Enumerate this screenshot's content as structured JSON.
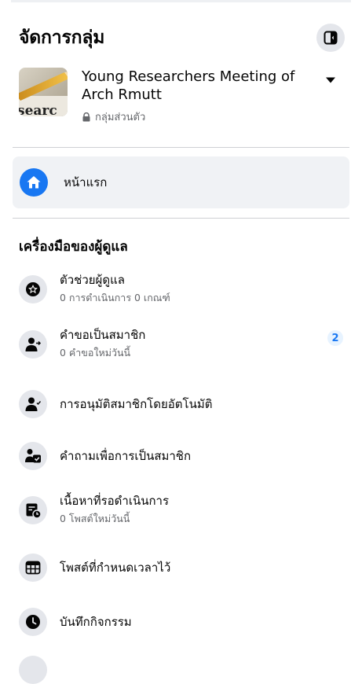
{
  "header": {
    "title": "จัดการกลุ่ม"
  },
  "group": {
    "name": "Young Researchers Meeting of Arch Rmutt",
    "privacy": "กลุ่มส่วนตัว",
    "thumbnail_text": "searc"
  },
  "nav": {
    "home_label": "หน้าแรก"
  },
  "admin_tools": {
    "title": "เครื่องมือของผู้ดูแล",
    "items": [
      {
        "label": "ตัวช่วยผู้ดูแล",
        "sub": "0 การดำเนินการ 0 เกณฑ์",
        "icon": "admin-assist-icon"
      },
      {
        "label": "คำขอเป็นสมาชิก",
        "sub": "0 คำขอใหม่วันนี้",
        "badge": "2",
        "icon": "member-request-icon"
      },
      {
        "label": "การอนุมัติสมาชิกโดยอัตโนมัติ",
        "icon": "auto-approve-icon"
      },
      {
        "label": "คำถามเพื่อการเป็นสมาชิก",
        "icon": "membership-question-icon"
      },
      {
        "label": "เนื้อหาที่รอดำเนินการ",
        "sub": "0 โพสต์ใหม่วันนี้",
        "icon": "pending-content-icon"
      },
      {
        "label": "โพสต์ที่กำหนดเวลาไว้",
        "icon": "scheduled-post-icon"
      },
      {
        "label": "บันทึกกิจกรรม",
        "icon": "activity-log-icon"
      }
    ]
  },
  "colors": {
    "accent": "#1877f2",
    "icon_bg": "#e4e6eb",
    "selected_bg": "#f0f2f5"
  }
}
